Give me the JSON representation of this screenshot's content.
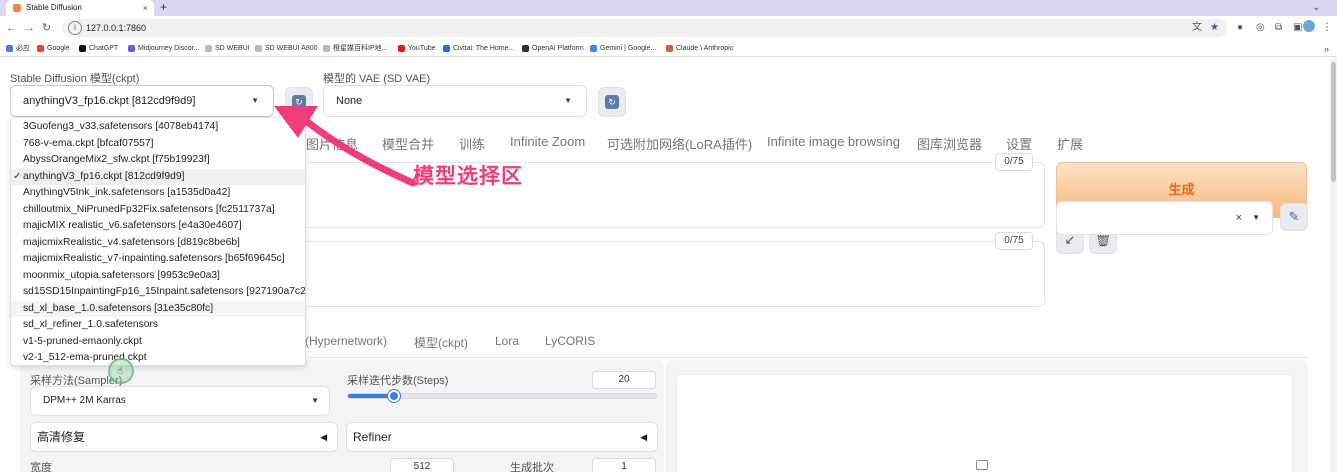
{
  "browser": {
    "tab_title": "Stable Diffusion",
    "tab_close": "×",
    "new_tab": "+",
    "url": "127.0.0.1:7860",
    "bookmarks": [
      "必应",
      "Google",
      "ChatGPT",
      "Midjourney Discor...",
      "SD WEBUI",
      "SD WEBUI A800",
      "橙星媒百科IP地...",
      "YouTube",
      "Civitai: The Home...",
      "OpenAI Platform",
      "Gemini | Google...",
      "Claude \\ Anthropic"
    ]
  },
  "model_select": {
    "label": "Stable Diffusion 模型(ckpt)",
    "value": "anythingV3_fp16.ckpt [812cd9f9d9]"
  },
  "vae_select": {
    "label": "模型的 VAE (SD VAE)",
    "value": "None"
  },
  "main_tabs": [
    "图片信息",
    "模型合并",
    "训练",
    "Infinite Zoom",
    "可选附加网络(LoRA插件)",
    "Infinite image browsing",
    "图库浏览器",
    "设置",
    "扩展"
  ],
  "prompt": {
    "counter": "0/75"
  },
  "negative_prompt": {
    "counter": "0/75"
  },
  "generate_button": "生成",
  "tool_buttons": {
    "arrow": "↙",
    "trash": "🗑",
    "pen": "✎"
  },
  "styles": {
    "clear": "×"
  },
  "sub_tabs": [
    "(Hypernetwork)",
    "模型(ckpt)",
    "Lora",
    "LyCORIS"
  ],
  "settings": {
    "sampler_label": "采样方法(Sampler)",
    "sampler_value": "DPM++ 2M Karras",
    "steps_label": "采样迭代步数(Steps)",
    "steps_value": "20",
    "steps_min": 1,
    "steps_max": 150,
    "hires_label": "高清修复",
    "refiner_label": "Refiner",
    "width_label": "宽度",
    "width_value": "512",
    "batch_count_label": "生成批次",
    "batch_count_value": "1"
  },
  "dropdown": {
    "items": [
      "3Guofeng3_v33.safetensors [4078eb4174]",
      "768-v-ema.ckpt [bfcaf07557]",
      "AbyssOrangeMix2_sfw.ckpt [f75b19923f]",
      "anythingV3_fp16.ckpt [812cd9f9d9]",
      "AnythingV5Ink_ink.safetensors [a1535d0a42]",
      "chilloutmix_NiPrunedFp32Fix.safetensors [fc2511737a]",
      "majicMIX realistic_v6.safetensors [e4a30e4607]",
      "majicmixRealistic_v4.safetensors [d819c8be6b]",
      "majicmixRealistic_v7-inpainting.safetensors [b65f69645c]",
      "moonmix_utopia.safetensors [9953c9e0a3]",
      "sd15SD15InpaintingFp16_15Inpaint.safetensors [927190a7c2]",
      "sd_xl_base_1.0.safetensors [31e35c80fc]",
      "sd_xl_refiner_1.0.safetensors",
      "v1-5-pruned-emaonly.ckpt",
      "v2-1_512-ema-pruned.ckpt"
    ],
    "selected_index": 3,
    "check_mark": "✓"
  },
  "annotation": {
    "text": "模型选择区",
    "color": "#f03c7a"
  },
  "colors": {
    "accent": "#e26a15",
    "slider": "#3b7ddd",
    "chrome": "#ddd6f3"
  }
}
